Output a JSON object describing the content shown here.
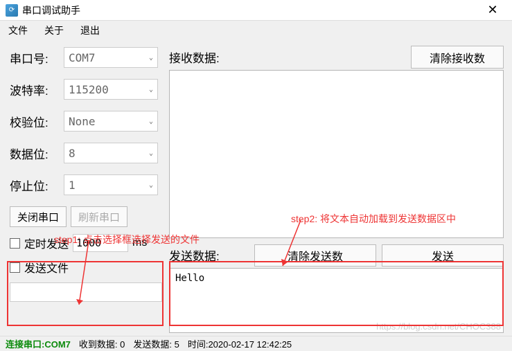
{
  "title": "串口调试助手",
  "menu": {
    "file": "文件",
    "about": "关于",
    "exit": "退出"
  },
  "left": {
    "port_label": "串口号:",
    "port_value": "COM7",
    "baud_label": "波特率:",
    "baud_value": "115200",
    "parity_label": "校验位:",
    "parity_value": "None",
    "data_label": "数据位:",
    "data_value": "8",
    "stop_label": "停止位:",
    "stop_value": "1",
    "close_btn": "关闭串口",
    "refresh_btn": "刷新串口",
    "timed_label": "定时发送",
    "interval_value": "1000",
    "interval_unit": "ms",
    "sendfile_label": "发送文件"
  },
  "right": {
    "recv_label": "接收数据:",
    "clear_recv_btn": "清除接收数",
    "send_label": "发送数据:",
    "clear_send_btn": "清除发送数",
    "send_btn": "发送",
    "send_text": "Hello"
  },
  "status": {
    "conn": "连接串口:COM7",
    "recv": "收到数据:  0",
    "sent": "发送数据:  5",
    "time": "时间:2020-02-17 12:42:25"
  },
  "watermark": "https://blog.csdn.net/CHOC388",
  "annotations": {
    "step1": "step1: 点击选择框选择发送的文件",
    "step2": "step2: 将文本自动加载到发送数据区中"
  }
}
